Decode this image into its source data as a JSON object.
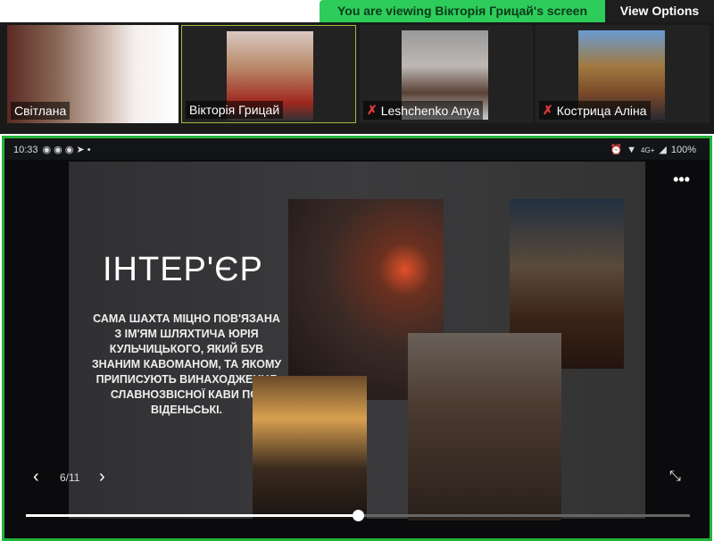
{
  "banner": {
    "text": "You are viewing Вікторія Грицай's screen",
    "view_options": "View Options"
  },
  "participants": [
    {
      "name": "Світлана",
      "muted": false
    },
    {
      "name": "Вікторія Грицай",
      "muted": false,
      "active": true
    },
    {
      "name": "Leshchenko Anya",
      "muted": true
    },
    {
      "name": "Кострица Аліна",
      "muted": true
    }
  ],
  "status_bar": {
    "time": "10:33",
    "network": "4G+",
    "battery": "100%"
  },
  "slide": {
    "title": "ІНТЕР'ЄР",
    "body": "САМА ШАХТА МІЦНО ПОВ'ЯЗАНА З ІМ'ЯМ ШЛЯХТИЧА ЮРІЯ КУЛЬЧИЦЬКОГО, ЯКИЙ БУВ ЗНАНИМ КАВОМАНОМ, ТА ЯКОМУ ПРИПИСУЮТЬ ВИНАХОДЖЕННЯ СЛАВНОЗВІСНОЇ КАВИ ПО-ВІДЕНЬСЬКІ."
  },
  "player": {
    "page": "6/11",
    "progress_percent": 50,
    "prev": "‹",
    "next": "›",
    "more": "•••",
    "collapse": "⤡"
  }
}
